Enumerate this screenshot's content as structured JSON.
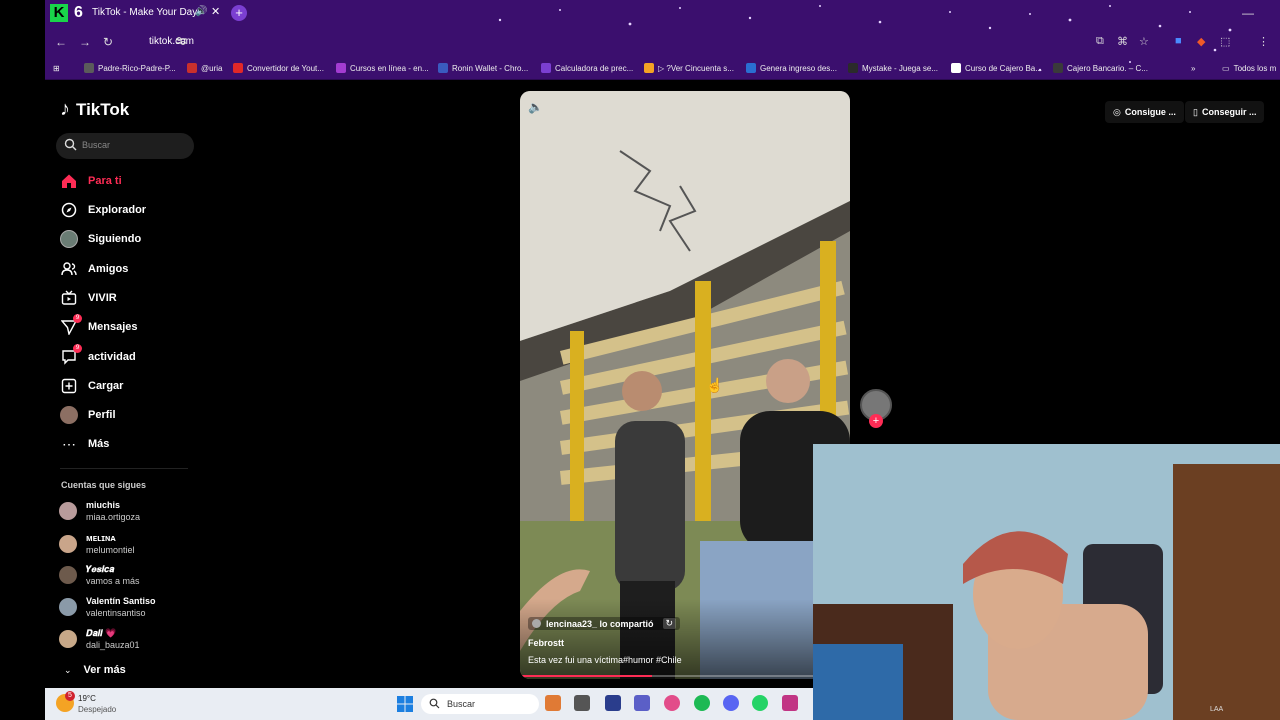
{
  "browser": {
    "tab_title": "TikTok - Make Your Day",
    "url": "tiktok.com",
    "bookmarks": [
      {
        "label": "Padre-Rico-Padre-P...",
        "color": "#5b5b5b"
      },
      {
        "label": "@uria",
        "color": "#c9302c"
      },
      {
        "label": "Convertidor de Yout...",
        "color": "#e12828"
      },
      {
        "label": "Cursos en línea - en...",
        "color": "#a33cd1"
      },
      {
        "label": "Ronin Wallet - Chro...",
        "color": "#3a5bbf"
      },
      {
        "label": "Calculadora de prec...",
        "color": "#7b3fd1"
      },
      {
        "label": "▷ ?Ver Cincuenta s...",
        "color": "#f4a324"
      },
      {
        "label": "Genera ingreso des...",
        "color": "#2a6ed1"
      },
      {
        "label": "Mystake - Juega se...",
        "color": "#2b2b2b"
      },
      {
        "label": "Curso de Cajero Ba...",
        "color": "#ffffff"
      },
      {
        "label": "Cajero Bancario. – C...",
        "color": "#3a3a3a"
      }
    ],
    "all_bookmarks": "Todos los m"
  },
  "tiktok": {
    "logo": "TikTok",
    "search_placeholder": "Buscar",
    "nav": [
      {
        "label": "Para ti",
        "icon": "home-icon",
        "active": true
      },
      {
        "label": "Explorador",
        "icon": "compass-icon",
        "active": false
      },
      {
        "label": "Siguiendo",
        "icon": "following-avatar-icon",
        "active": false
      },
      {
        "label": "Amigos",
        "icon": "friends-icon",
        "active": false
      },
      {
        "label": "VIVIR",
        "icon": "live-tv-icon",
        "active": false
      },
      {
        "label": "Mensajes",
        "icon": "send-icon",
        "active": false,
        "badge": "9"
      },
      {
        "label": "actividad",
        "icon": "activity-icon",
        "active": false,
        "badge": "9"
      },
      {
        "label": "Cargar",
        "icon": "upload-icon",
        "active": false
      },
      {
        "label": "Perfil",
        "icon": "profile-avatar-icon",
        "active": false
      },
      {
        "label": "Más",
        "icon": "more-dots-icon",
        "active": false
      }
    ],
    "following_title": "Cuentas que sigues",
    "following": [
      {
        "name": "miuchis",
        "user": "miaa.ortigoza",
        "color": "#b89b9b"
      },
      {
        "name": "ᴍᴇʟɪɴᴀ",
        "user": "melumontiel",
        "color": "#c9a58a"
      },
      {
        "name": "𝒀𝒆𝒔𝒊𝒄𝒂",
        "user": "vamos a más",
        "color": "#6d5a4c"
      },
      {
        "name": "Valentín Santiso",
        "user": "valentinsantiso",
        "color": "#8a9aa8"
      },
      {
        "name": "𝑫𝒂𝒍𝒊 💗",
        "user": "dali_bauza01",
        "color": "#c7a888"
      }
    ],
    "see_more": "Ver más",
    "top_buttons": [
      "Consigue ...",
      "Conseguir ..."
    ],
    "video": {
      "reposted": "lencinaa23_ lo compartió",
      "author": "Febrostt",
      "description": "Esta vez fui una víctima#humor  #Chile",
      "progress": 0.4
    }
  },
  "taskbar": {
    "weather_temp": "19°C",
    "weather_cond": "Despejado",
    "weather_badge": "5",
    "search_label": "Buscar",
    "lang": "LAA"
  }
}
